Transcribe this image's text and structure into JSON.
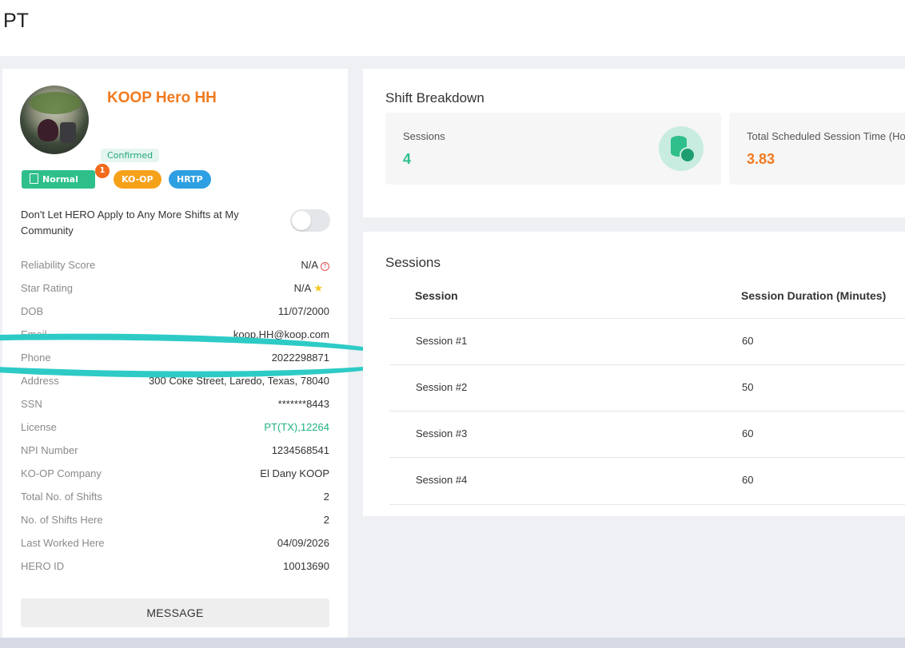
{
  "page": {
    "title": "PT"
  },
  "profile": {
    "name": "KOOP Hero HH",
    "status": "Confirmed",
    "tags": {
      "normal_doc": "Normal Doc",
      "koop": "KO-OP",
      "hrtp": "HRTP"
    },
    "doc_badge_count": "1",
    "toggle_label": "Don't Let HERO Apply to Any More Shifts at My Community",
    "toggle_state": false,
    "fields": [
      {
        "label": "Reliability Score",
        "value": "N/A"
      },
      {
        "label": "Star Rating",
        "value": "N/A"
      },
      {
        "label": "DOB",
        "value": "11/07/2000"
      },
      {
        "label": "Email",
        "value": "koop.HH@koop.com"
      },
      {
        "label": "Phone",
        "value": "2022298871"
      },
      {
        "label": "Address",
        "value": "300 Coke Street, Laredo, Texas, 78040"
      },
      {
        "label": "SSN",
        "value": "*******8443"
      },
      {
        "label": "License",
        "value": "PT(TX),12264"
      },
      {
        "label": "NPI Number",
        "value": "1234568541"
      },
      {
        "label": "KO-OP Company",
        "value": "El Dany KOOP"
      },
      {
        "label": "Total No. of Shifts",
        "value": "2"
      },
      {
        "label": "No. of Shifts Here",
        "value": "2"
      },
      {
        "label": "Last Worked Here",
        "value": "04/09/2026"
      },
      {
        "label": "HERO ID",
        "value": "10013690"
      }
    ],
    "message_button": "MESSAGE"
  },
  "shift_breakdown": {
    "title": "Shift Breakdown",
    "sessions_label": "Sessions",
    "sessions_value": "4",
    "total_time_label": "Total Scheduled Session Time (Hours)",
    "total_time_value": "3.83",
    "colors": {
      "green": "#2fbf8b",
      "orange": "#f07a1f"
    }
  },
  "sessions": {
    "title": "Sessions",
    "columns": [
      "Session",
      "Session Duration (Minutes)"
    ],
    "rows": [
      {
        "session": "Session #1",
        "duration": "60"
      },
      {
        "session": "Session #2",
        "duration": "50"
      },
      {
        "session": "Session #3",
        "duration": "60"
      },
      {
        "session": "Session #4",
        "duration": "60"
      }
    ]
  }
}
